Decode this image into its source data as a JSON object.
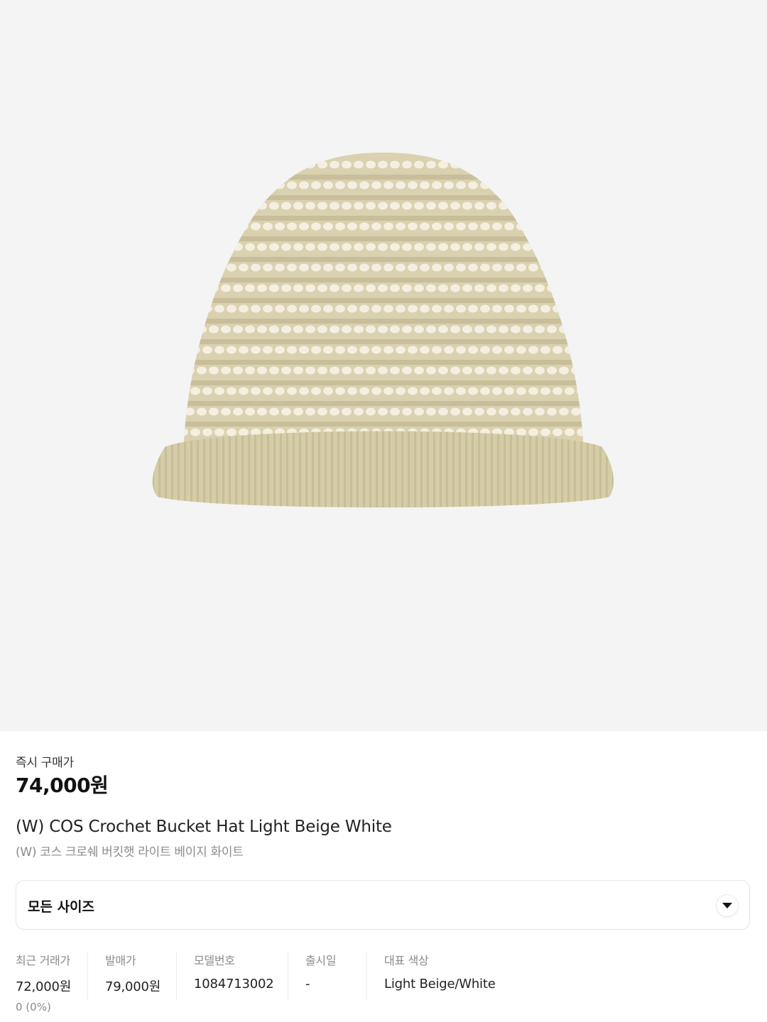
{
  "product_image": {
    "alt_icon": "crochet-bucket-hat-image"
  },
  "buy_now": {
    "label": "즉시 구매가",
    "price": "74,000원"
  },
  "product": {
    "title_en": "(W) COS Crochet Bucket Hat Light Beige White",
    "title_ko": "(W) 코스 크로쉐 버킷햇 라이트 베이지 화이트"
  },
  "size_selector": {
    "label": "모든 사이즈",
    "icon": "chevron-down-icon"
  },
  "details": {
    "recent_trade": {
      "label": "최근 거래가",
      "value": "72,000원",
      "change": "0 (0%)"
    },
    "release_price": {
      "label": "발매가",
      "value": "79,000원"
    },
    "model_number": {
      "label": "모델번호",
      "value": "1084713002"
    },
    "release_date": {
      "label": "출시일",
      "value": "-"
    },
    "main_color": {
      "label": "대표 색상",
      "value": "Light Beige/White"
    }
  },
  "colors": {
    "hero_bg": "#f4f4f4",
    "hat_base": "#d9d1b0",
    "hat_bead": "#f4efe0",
    "text_primary": "#222222",
    "text_secondary": "#8b8b8b"
  }
}
